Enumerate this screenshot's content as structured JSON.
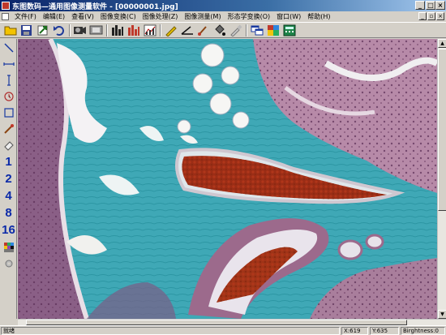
{
  "window": {
    "title": "东图数码—通用图像测量软件 - [00000001.jpg]",
    "minimize_glyph": "_",
    "maximize_glyph": "□",
    "close_glyph": "×"
  },
  "menu": {
    "items": [
      {
        "label": "文件(F)"
      },
      {
        "label": "编辑(E)"
      },
      {
        "label": "查看(V)"
      },
      {
        "label": "图像变换(C)"
      },
      {
        "label": "图像处理(Z)"
      },
      {
        "label": "图像测量(M)"
      },
      {
        "label": "形态学变换(O)"
      },
      {
        "label": "窗口(W)"
      },
      {
        "label": "帮助(H)"
      }
    ],
    "mdi_glyphs": [
      "_",
      "▫",
      "×"
    ]
  },
  "toolbar": {
    "buttons": [
      {
        "icon": "open-folder-icon"
      },
      {
        "icon": "save-icon"
      },
      {
        "icon": "arrow-icon"
      },
      {
        "icon": "undo-icon"
      },
      {
        "icon": "camera-icon"
      },
      {
        "icon": "film-icon"
      },
      {
        "icon": "histogram-icon"
      },
      {
        "icon": "histogram-color-icon"
      },
      {
        "icon": "chart-icon"
      },
      {
        "icon": "pencil-icon"
      },
      {
        "icon": "angle-icon"
      },
      {
        "icon": "brush-icon"
      },
      {
        "icon": "fill-icon"
      },
      {
        "icon": "pipette-icon"
      },
      {
        "icon": "windows-icon"
      },
      {
        "icon": "grid-icon"
      },
      {
        "icon": "calculator-icon"
      }
    ]
  },
  "palette": {
    "tools": [
      {
        "icon": "line-icon"
      },
      {
        "icon": "horizontal-line-icon"
      },
      {
        "icon": "vertical-line-icon"
      },
      {
        "icon": "clock-icon"
      },
      {
        "icon": "rectangle-icon"
      },
      {
        "icon": "pointer-icon"
      },
      {
        "icon": "eraser-icon"
      }
    ],
    "line_widths": [
      "1",
      "2",
      "4",
      "8",
      "16"
    ]
  },
  "status": {
    "ready": "就绪",
    "x": "X:619",
    "y": "Y:635",
    "brightness": "Birghtness:0"
  }
}
